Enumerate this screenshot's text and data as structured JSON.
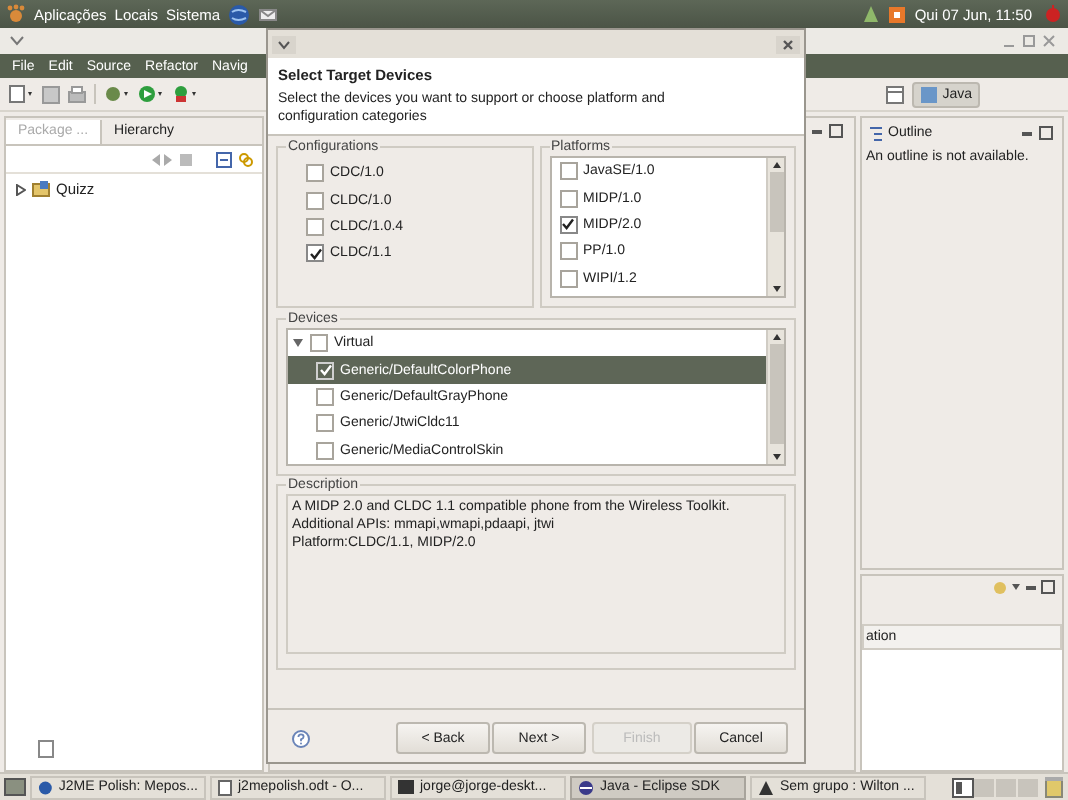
{
  "top_panel": {
    "menus": [
      "Aplicações",
      "Locais",
      "Sistema"
    ],
    "clock": "Qui 07 Jun, 11:50"
  },
  "eclipse": {
    "menu": [
      "File",
      "Edit",
      "Source",
      "Refactor",
      "Navig"
    ],
    "perspective": "Java",
    "left_tabs": [
      {
        "label": "Package ...",
        "selected": true
      },
      {
        "label": "Hierarchy",
        "selected": false
      }
    ],
    "tree": [
      {
        "label": "Quizz",
        "expanded": false
      }
    ],
    "outline": {
      "tab": "Outline",
      "message": "An outline is not available."
    },
    "bottom_panel": {
      "column": "ation"
    }
  },
  "dialog": {
    "title": "Select Target Devices",
    "description": "Select the devices you want to support or choose platform and configuration categories",
    "configurations": {
      "label": "Configurations",
      "items": [
        {
          "label": "CDC/1.0",
          "checked": false
        },
        {
          "label": "CLDC/1.0",
          "checked": false
        },
        {
          "label": "CLDC/1.0.4",
          "checked": false
        },
        {
          "label": "CLDC/1.1",
          "checked": true
        }
      ]
    },
    "platforms": {
      "label": "Platforms",
      "items": [
        {
          "label": "JavaSE/1.0",
          "checked": false
        },
        {
          "label": "MIDP/1.0",
          "checked": false
        },
        {
          "label": "MIDP/2.0",
          "checked": true
        },
        {
          "label": "PP/1.0",
          "checked": false
        },
        {
          "label": "WIPI/1.2",
          "checked": false
        }
      ]
    },
    "devices": {
      "label": "Devices",
      "groups": [
        {
          "label": "Virtual",
          "expanded": true,
          "checked": false,
          "children": [
            {
              "label": "Generic/DefaultColorPhone",
              "checked": true,
              "selected": true
            },
            {
              "label": "Generic/DefaultGrayPhone",
              "checked": false,
              "selected": false
            },
            {
              "label": "Generic/JtwiCldc11",
              "checked": false,
              "selected": false
            },
            {
              "label": "Generic/MediaControlSkin",
              "checked": false,
              "selected": false
            }
          ]
        }
      ]
    },
    "details": {
      "label": "Description",
      "lines": [
        "A MIDP 2.0 and CLDC 1.1 compatible phone from the Wireless Toolkit.",
        "Additional APIs: mmapi,wmapi,pdaapi, jtwi",
        "Platform:CLDC/1.1, MIDP/2.0"
      ]
    },
    "buttons": [
      {
        "label": "< Back",
        "disabled": false
      },
      {
        "label": "Next >",
        "disabled": false
      },
      {
        "label": "Finish",
        "disabled": true
      },
      {
        "label": "Cancel",
        "disabled": false
      }
    ]
  },
  "taskbar": [
    {
      "label": "J2ME Polish: Mepos...",
      "kind": "browser",
      "selected": false
    },
    {
      "label": "j2mepolish.odt - O...",
      "kind": "document",
      "selected": false
    },
    {
      "label": "jorge@jorge-deskt...",
      "kind": "terminal",
      "selected": false
    },
    {
      "label": "Java - Eclipse SDK",
      "kind": "eclipse",
      "selected": true
    },
    {
      "label": "Sem grupo : Wilton ...",
      "kind": "chat",
      "selected": false
    }
  ]
}
